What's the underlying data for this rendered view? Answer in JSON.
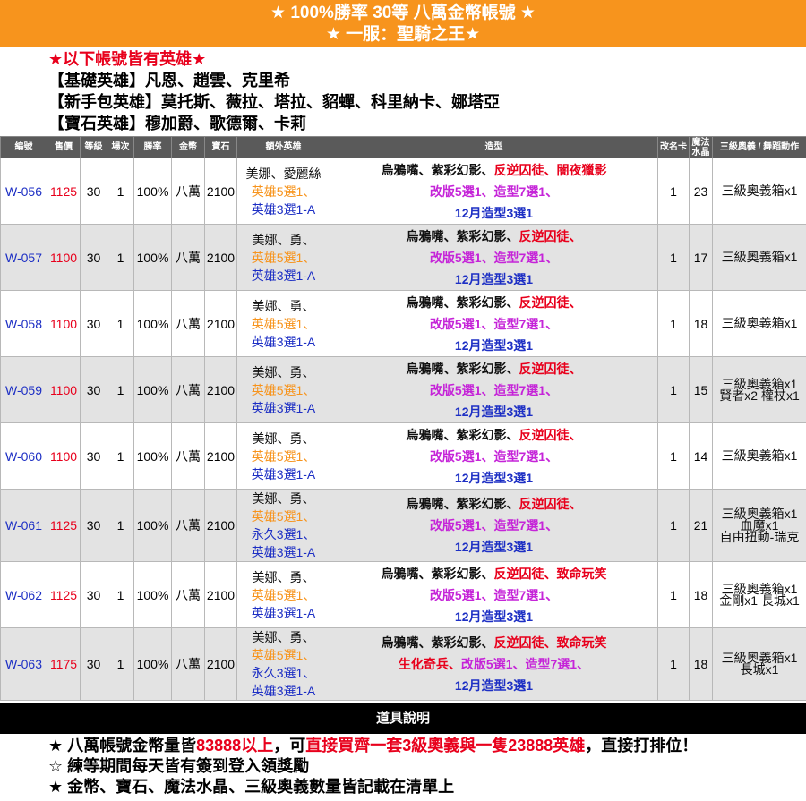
{
  "banner": {
    "line1": "★ 100%勝率 30等 八萬金幣帳號 ★",
    "line2": "★ 一服：聖騎之王★"
  },
  "intro": {
    "heading": "★以下帳號皆有英雄★",
    "basic": "【基礎英雄】凡恩、趙雲、克里希",
    "starter": "【新手包英雄】莫托斯、薇拉、塔拉、貂蟬、科里納卡、娜塔亞",
    "gem": "【寶石英雄】穆加爵、歌德爾、卡莉"
  },
  "columns": [
    "編號",
    "售價",
    "等級",
    "場次",
    "勝率",
    "金幣",
    "寶石",
    "額外英雄",
    "造型",
    "改名卡",
    "魔法水晶",
    "三級奧義 / 舞蹈動作"
  ],
  "rows": [
    {
      "id": "W-056",
      "price": "1125",
      "level": "30",
      "games": "1",
      "rate": "100%",
      "gold": "八萬",
      "gem": "2100",
      "h1": "美娜、愛麗絲",
      "h2": "英雄5選1、",
      "h3": "英雄3選1-A",
      "h4": "",
      "s1a": "烏鴉嘴、紫彩幻影、",
      "s1b": "反逆囚徒、闇夜獵影",
      "s2a": "改版5選1、造型7選1、",
      "s2b": "",
      "s3": "12月造型3選1",
      "card": "1",
      "crystal": "23",
      "box1": "三級奧義箱x1",
      "box2": "",
      "box3": ""
    },
    {
      "id": "W-057",
      "price": "1100",
      "level": "30",
      "games": "1",
      "rate": "100%",
      "gold": "八萬",
      "gem": "2100",
      "h1": "美娜、勇、",
      "h2": "英雄5選1、",
      "h3": "英雄3選1-A",
      "h4": "",
      "s1a": "烏鴉嘴、紫彩幻影、",
      "s1b": "反逆囚徒、",
      "s2a": "改版5選1、造型7選1、",
      "s2b": "",
      "s3": "12月造型3選1",
      "card": "1",
      "crystal": "17",
      "box1": "三級奧義箱x1",
      "box2": "",
      "box3": ""
    },
    {
      "id": "W-058",
      "price": "1100",
      "level": "30",
      "games": "1",
      "rate": "100%",
      "gold": "八萬",
      "gem": "2100",
      "h1": "美娜、勇、",
      "h2": "英雄5選1、",
      "h3": "英雄3選1-A",
      "h4": "",
      "s1a": "烏鴉嘴、紫彩幻影、",
      "s1b": "反逆囚徒、",
      "s2a": "改版5選1、造型7選1、",
      "s2b": "",
      "s3": "12月造型3選1",
      "card": "1",
      "crystal": "18",
      "box1": "三級奧義箱x1",
      "box2": "",
      "box3": ""
    },
    {
      "id": "W-059",
      "price": "1100",
      "level": "30",
      "games": "1",
      "rate": "100%",
      "gold": "八萬",
      "gem": "2100",
      "h1": "美娜、勇、",
      "h2": "英雄5選1、",
      "h3": "英雄3選1-A",
      "h4": "",
      "s1a": "烏鴉嘴、紫彩幻影、",
      "s1b": "反逆囚徒、",
      "s2a": "改版5選1、造型7選1、",
      "s2b": "",
      "s3": "12月造型3選1",
      "card": "1",
      "crystal": "15",
      "box1": "三級奧義箱x1",
      "box2": "賢者x2 權杖x1",
      "box3": ""
    },
    {
      "id": "W-060",
      "price": "1100",
      "level": "30",
      "games": "1",
      "rate": "100%",
      "gold": "八萬",
      "gem": "2100",
      "h1": "美娜、勇、",
      "h2": "英雄5選1、",
      "h3": "英雄3選1-A",
      "h4": "",
      "s1a": "烏鴉嘴、紫彩幻影、",
      "s1b": "反逆囚徒、",
      "s2a": "改版5選1、造型7選1、",
      "s2b": "",
      "s3": "12月造型3選1",
      "card": "1",
      "crystal": "14",
      "box1": "三級奧義箱x1",
      "box2": "",
      "box3": ""
    },
    {
      "id": "W-061",
      "price": "1125",
      "level": "30",
      "games": "1",
      "rate": "100%",
      "gold": "八萬",
      "gem": "2100",
      "h1": "美娜、勇、",
      "h2": "英雄5選1、",
      "h3": "永久3選1、",
      "h4": "英雄3選1-A",
      "s1a": "烏鴉嘴、紫彩幻影、",
      "s1b": "反逆囚徒、",
      "s2a": "改版5選1、造型7選1、",
      "s2b": "",
      "s3": "12月造型3選1",
      "card": "1",
      "crystal": "21",
      "box1": "三級奧義箱x1",
      "box2": "血魔x1",
      "box3": "自由扭動-瑞克"
    },
    {
      "id": "W-062",
      "price": "1125",
      "level": "30",
      "games": "1",
      "rate": "100%",
      "gold": "八萬",
      "gem": "2100",
      "h1": "美娜、勇、",
      "h2": "英雄5選1、",
      "h3": "英雄3選1-A",
      "h4": "",
      "s1a": "烏鴉嘴、紫彩幻影、",
      "s1b": "反逆囚徒、致命玩笑",
      "s2a": "改版5選1、造型7選1、",
      "s2b": "",
      "s3": "12月造型3選1",
      "card": "1",
      "crystal": "18",
      "box1": "三級奧義箱x1",
      "box2": "金剛x1 長城x1",
      "box3": ""
    },
    {
      "id": "W-063",
      "price": "1175",
      "level": "30",
      "games": "1",
      "rate": "100%",
      "gold": "八萬",
      "gem": "2100",
      "h1": "美娜、勇、",
      "h2": "英雄5選1、",
      "h3": "永久3選1、",
      "h4": "英雄3選1-A",
      "s1a": "烏鴉嘴、紫彩幻影、",
      "s1b": "反逆囚徒、致命玩笑",
      "s2a": "改版5選1、造型7選1、",
      "s2b": "生化奇兵、",
      "s3": "12月造型3選1",
      "card": "1",
      "crystal": "18",
      "box1": "三級奧義箱x1",
      "box2": "長城x1",
      "box3": ""
    }
  ],
  "footer": {
    "heading": "道具說明",
    "n1a": "★ 八萬帳號金幣量皆",
    "n1b": "83888以上",
    "n1c": "，可",
    "n1d": "直接買齊一套3級奧義與一隻23888英雄",
    "n1e": "，直接打排位！",
    "n2": "☆ 練等期間每天皆有簽到登入領獎勵",
    "n3": "★ 金幣、寶石、魔法水晶、三級奧義數量皆記載在清單上"
  }
}
